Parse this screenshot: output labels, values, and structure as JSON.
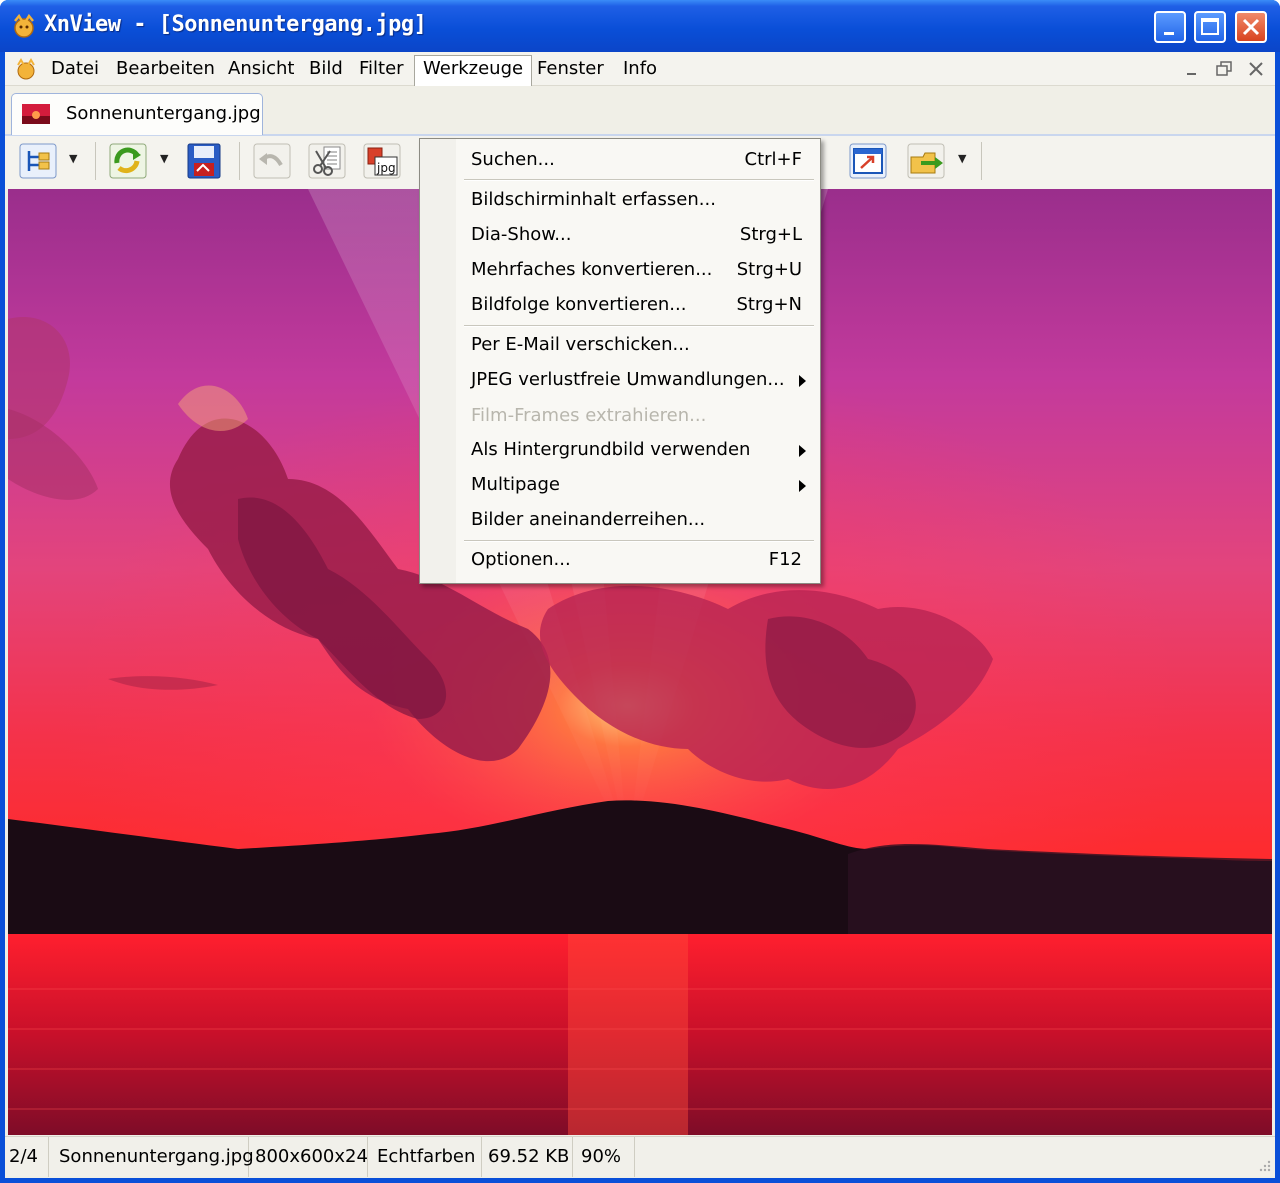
{
  "window": {
    "title": "XnView - [Sonnenuntergang.jpg]"
  },
  "menubar": {
    "items": [
      "Datei",
      "Bearbeiten",
      "Ansicht",
      "Bild",
      "Filter",
      "Werkzeuge",
      "Fenster",
      "Info"
    ],
    "active": "Werkzeuge"
  },
  "tab": {
    "label": "Sonnenuntergang.jpg"
  },
  "toolbar": {
    "icons": [
      "browser-icon",
      "refresh-icon",
      "save-icon",
      "undo-icon",
      "cut-icon",
      "convert-jpg-icon",
      "fit-window-icon",
      "export-icon"
    ]
  },
  "dropdown": {
    "items": [
      {
        "label": "Suchen...",
        "shortcut": "Ctrl+F",
        "submenu": false,
        "disabled": false
      },
      {
        "label": "Bildschirminhalt erfassen...",
        "shortcut": "",
        "submenu": false,
        "disabled": false
      },
      {
        "label": "Dia-Show...",
        "shortcut": "Strg+L",
        "submenu": false,
        "disabled": false
      },
      {
        "label": "Mehrfaches konvertieren...",
        "shortcut": "Strg+U",
        "submenu": false,
        "disabled": false
      },
      {
        "label": "Bildfolge konvertieren...",
        "shortcut": "Strg+N",
        "submenu": false,
        "disabled": false
      },
      {
        "label": "Per E-Mail verschicken...",
        "shortcut": "",
        "submenu": false,
        "disabled": false
      },
      {
        "label": "JPEG verlustfreie Umwandlungen...",
        "shortcut": "",
        "submenu": true,
        "disabled": false
      },
      {
        "label": "Film-Frames extrahieren...",
        "shortcut": "",
        "submenu": false,
        "disabled": true
      },
      {
        "label": "Als Hintergrundbild verwenden",
        "shortcut": "",
        "submenu": true,
        "disabled": false
      },
      {
        "label": "Multipage",
        "shortcut": "",
        "submenu": true,
        "disabled": false
      },
      {
        "label": "Bilder aneinanderreihen...",
        "shortcut": "",
        "submenu": false,
        "disabled": false
      },
      {
        "label": "Optionen...",
        "shortcut": "F12",
        "submenu": false,
        "disabled": false
      }
    ]
  },
  "statusbar": {
    "index": "2/4",
    "filename": "Sonnenuntergang.jpg",
    "dimensions": "800x600x24",
    "colors": "Echtfarben",
    "filesize": "69.52 KB",
    "zoom": "90%"
  },
  "colors": {
    "titlebar": "#0a4fd8",
    "menu_bg": "#f9f8f4",
    "sky_top": "#a0308e",
    "sky_glow": "#ff2a2a"
  }
}
